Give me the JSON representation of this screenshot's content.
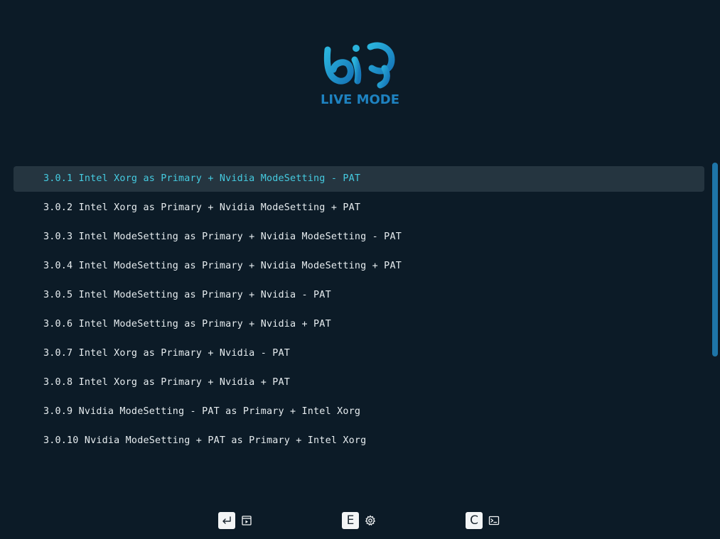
{
  "logo": {
    "brand_text": "LIVE MODE"
  },
  "menu": {
    "items": [
      {
        "label": "3.0.1 Intel Xorg as Primary + Nvidia ModeSetting - PAT",
        "selected": true
      },
      {
        "label": "3.0.2 Intel Xorg as Primary + Nvidia ModeSetting + PAT"
      },
      {
        "label": "3.0.3 Intel ModeSetting as Primary + Nvidia ModeSetting - PAT"
      },
      {
        "label": "3.0.4 Intel ModeSetting as Primary + Nvidia ModeSetting + PAT"
      },
      {
        "label": "3.0.5 Intel ModeSetting as Primary + Nvidia - PAT"
      },
      {
        "label": "3.0.6 Intel ModeSetting as Primary + Nvidia + PAT"
      },
      {
        "label": "3.0.7 Intel Xorg as Primary + Nvidia - PAT"
      },
      {
        "label": "3.0.8 Intel Xorg as Primary + Nvidia + PAT"
      },
      {
        "label": "3.0.9 Nvidia ModeSetting - PAT as Primary + Intel Xorg"
      },
      {
        "label": "3.0.10 Nvidia ModeSetting + PAT as Primary + Intel Xorg"
      }
    ]
  },
  "hints": [
    {
      "key": "enter-key",
      "action_icon": "boot-icon"
    },
    {
      "key": "E",
      "action_icon": "gear-icon"
    },
    {
      "key": "C",
      "action_icon": "terminal-icon"
    }
  ],
  "colors": {
    "background": "#0c1b27",
    "accent": "#45cbe0",
    "brand": "#1e82c0",
    "selection": "#253540",
    "scrollbar": "#1e75a8"
  }
}
